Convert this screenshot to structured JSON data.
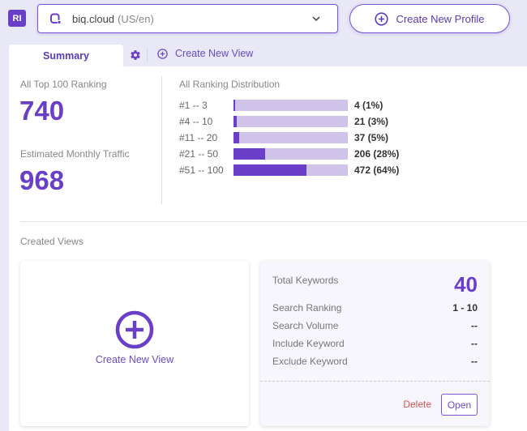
{
  "header": {
    "logo_text": "RI",
    "profile_select": {
      "site": "biq.cloud",
      "locale": "(US/en)",
      "icon": "site-icon",
      "dropdown_icon": "chevron-down-icon"
    },
    "create_profile_label": "Create New Profile"
  },
  "tabs": {
    "summary_label": "Summary",
    "settings_icon": "gear-icon",
    "create_view_label": "Create New View"
  },
  "summary": {
    "top100_label": "All Top 100 Ranking",
    "top100_value": "740",
    "traffic_label": "Estimated Monthly Traffic",
    "traffic_value": "968"
  },
  "distribution": {
    "title": "All Ranking Distribution",
    "rows": [
      {
        "range": "#1 -- 3",
        "count_label": "4 (1%)",
        "percent": 1
      },
      {
        "range": "#4 -- 10",
        "count_label": "21 (3%)",
        "percent": 3
      },
      {
        "range": "#11 -- 20",
        "count_label": "37 (5%)",
        "percent": 5
      },
      {
        "range": "#21 -- 50",
        "count_label": "206 (28%)",
        "percent": 28
      },
      {
        "range": "#51 -- 100",
        "count_label": "472 (64%)",
        "percent": 64
      }
    ]
  },
  "created_views": {
    "title": "Created Views",
    "new_view_label": "Create New View",
    "view_card": {
      "total_keywords_label": "Total Keywords",
      "total_keywords_value": "40",
      "rows": [
        {
          "label": "Search Ranking",
          "value": "1 - 10"
        },
        {
          "label": "Search Volume",
          "value": "--"
        },
        {
          "label": "Include Keyword",
          "value": "--"
        },
        {
          "label": "Exclude Keyword",
          "value": "--"
        }
      ],
      "delete_label": "Delete",
      "open_label": "Open"
    }
  },
  "colors": {
    "accent": "#6a3fc7",
    "bar_track": "#d0c3ea",
    "danger": "#d9534f",
    "background": "#e8e8f6"
  }
}
